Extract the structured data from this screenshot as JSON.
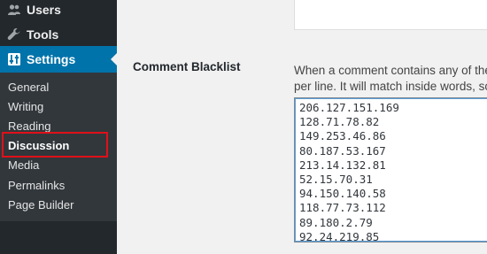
{
  "sidebar": {
    "menu": [
      {
        "label": "Users",
        "icon": "users-icon"
      },
      {
        "label": "Tools",
        "icon": "wrench-icon"
      },
      {
        "label": "Settings",
        "icon": "settings-icon",
        "active": true
      }
    ],
    "submenu": [
      {
        "label": "General"
      },
      {
        "label": "Writing"
      },
      {
        "label": "Reading"
      },
      {
        "label": "Discussion",
        "current": true
      },
      {
        "label": "Media"
      },
      {
        "label": "Permalinks"
      },
      {
        "label": "Page Builder"
      }
    ]
  },
  "main": {
    "comment_blacklist": {
      "label": "Comment Blacklist",
      "description_line1": "When a comment contains any of these",
      "description_line2": "per line. It will match inside words, so “p",
      "ips": [
        "206.127.151.169",
        "128.71.78.82",
        "149.253.46.86",
        "80.187.53.167",
        "213.14.132.81",
        "52.15.70.31",
        "94.150.140.58",
        "118.77.73.112",
        "89.180.2.79",
        "92.24.219.85"
      ]
    }
  },
  "colors": {
    "sidebar_bg": "#23282d",
    "submenu_bg": "#32373c",
    "active_bg": "#0073aa",
    "highlight": "#e0101a"
  }
}
